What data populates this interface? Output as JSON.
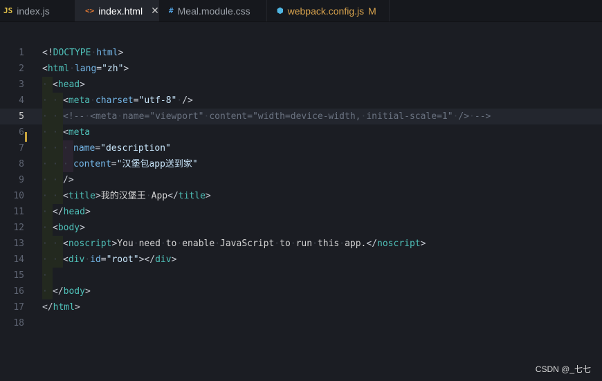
{
  "tabs": [
    {
      "icon": "JS",
      "label": "index.js",
      "active": false
    },
    {
      "icon": "<>",
      "label": "index.html",
      "active": true,
      "close": "✕"
    },
    {
      "icon": "#",
      "label": "Meal.module.css",
      "active": false
    },
    {
      "icon": "⬢",
      "label": "webpack.config.js",
      "active": false,
      "modified": "M"
    }
  ],
  "colors": {
    "background": "#1b1d23",
    "tag": "#4fc1b9",
    "attribute": "#73b5e6",
    "string": "#c9e6fb",
    "comment": "#6a7280",
    "modified": "#d7a24d"
  },
  "code": {
    "current_line": 5,
    "line_numbers": [
      "1",
      "2",
      "3",
      "4",
      "5",
      "6",
      "7",
      "8",
      "9",
      "10",
      "11",
      "12",
      "13",
      "14",
      "15",
      "16",
      "17",
      "18"
    ],
    "lines": [
      {
        "indent": 0,
        "tokens": [
          [
            "br",
            "<!"
          ],
          [
            "tag",
            "DOCTYPE"
          ],
          [
            "sp"
          ],
          [
            "attr",
            "html"
          ],
          [
            "br",
            ">"
          ]
        ]
      },
      {
        "indent": 0,
        "tokens": [
          [
            "br",
            "<"
          ],
          [
            "tag",
            "html"
          ],
          [
            "sp"
          ],
          [
            "attr",
            "lang"
          ],
          [
            "br",
            "="
          ],
          [
            "str",
            "\"zh\""
          ],
          [
            "br",
            ">"
          ]
        ]
      },
      {
        "indent": 1,
        "tokens": [
          [
            "br",
            "<"
          ],
          [
            "tag",
            "head"
          ],
          [
            "br",
            ">"
          ]
        ]
      },
      {
        "indent": 2,
        "tokens": [
          [
            "br",
            "<"
          ],
          [
            "tag",
            "meta"
          ],
          [
            "sp"
          ],
          [
            "attr",
            "charset"
          ],
          [
            "br",
            "="
          ],
          [
            "str",
            "\"utf-8\""
          ],
          [
            "sp"
          ],
          [
            "br",
            "/>"
          ]
        ]
      },
      {
        "indent": 2,
        "tokens": [
          [
            "cm",
            "<!--"
          ],
          [
            "sp"
          ],
          [
            "cm",
            "<meta"
          ],
          [
            "sp"
          ],
          [
            "cm",
            "name=\"viewport\""
          ],
          [
            "sp"
          ],
          [
            "cm",
            "content=\"width=device-width,"
          ],
          [
            "sp"
          ],
          [
            "cm",
            "initial-scale=1\""
          ],
          [
            "sp"
          ],
          [
            "cm",
            "/>"
          ],
          [
            "sp"
          ],
          [
            "cm",
            "-->"
          ]
        ]
      },
      {
        "indent": 2,
        "tokens": [
          [
            "br",
            "<"
          ],
          [
            "tag",
            "meta"
          ]
        ]
      },
      {
        "indent": 3,
        "tokens": [
          [
            "attr",
            "name"
          ],
          [
            "br",
            "="
          ],
          [
            "str",
            "\"description\""
          ]
        ]
      },
      {
        "indent": 3,
        "tokens": [
          [
            "attr",
            "content"
          ],
          [
            "br",
            "="
          ],
          [
            "str",
            "\"汉堡包app送到家\""
          ]
        ]
      },
      {
        "indent": 2,
        "tokens": [
          [
            "br",
            "/>"
          ]
        ]
      },
      {
        "indent": 2,
        "tokens": [
          [
            "br",
            "<"
          ],
          [
            "tag",
            "title"
          ],
          [
            "br",
            ">"
          ],
          [
            "txt",
            "我的汉堡王"
          ],
          [
            "sp"
          ],
          [
            "txt",
            "App"
          ],
          [
            "br",
            "</"
          ],
          [
            "tag",
            "title"
          ],
          [
            "br",
            ">"
          ]
        ]
      },
      {
        "indent": 1,
        "tokens": [
          [
            "br",
            "</"
          ],
          [
            "tag",
            "head"
          ],
          [
            "br",
            ">"
          ]
        ]
      },
      {
        "indent": 1,
        "tokens": [
          [
            "br",
            "<"
          ],
          [
            "tag",
            "body"
          ],
          [
            "br",
            ">"
          ]
        ]
      },
      {
        "indent": 2,
        "tokens": [
          [
            "br",
            "<"
          ],
          [
            "tag",
            "noscript"
          ],
          [
            "br",
            ">"
          ],
          [
            "txt",
            "You"
          ],
          [
            "sp"
          ],
          [
            "txt",
            "need"
          ],
          [
            "sp"
          ],
          [
            "txt",
            "to"
          ],
          [
            "sp"
          ],
          [
            "txt",
            "enable"
          ],
          [
            "sp"
          ],
          [
            "txt",
            "JavaScript"
          ],
          [
            "sp"
          ],
          [
            "txt",
            "to"
          ],
          [
            "sp"
          ],
          [
            "txt",
            "run"
          ],
          [
            "sp"
          ],
          [
            "txt",
            "this"
          ],
          [
            "sp"
          ],
          [
            "txt",
            "app."
          ],
          [
            "br",
            "</"
          ],
          [
            "tag",
            "noscript"
          ],
          [
            "br",
            ">"
          ]
        ]
      },
      {
        "indent": 2,
        "tokens": [
          [
            "br",
            "<"
          ],
          [
            "tag",
            "div"
          ],
          [
            "sp"
          ],
          [
            "attr",
            "id"
          ],
          [
            "br",
            "="
          ],
          [
            "str",
            "\"root\""
          ],
          [
            "br",
            "></"
          ],
          [
            "tag",
            "div"
          ],
          [
            "br",
            ">"
          ]
        ]
      },
      {
        "indent": 1,
        "tokens": []
      },
      {
        "indent": 1,
        "tokens": [
          [
            "br",
            "</"
          ],
          [
            "tag",
            "body"
          ],
          [
            "br",
            ">"
          ]
        ]
      },
      {
        "indent": 0,
        "tokens": [
          [
            "br",
            "</"
          ],
          [
            "tag",
            "html"
          ],
          [
            "br",
            ">"
          ]
        ]
      },
      {
        "indent": 0,
        "tokens": []
      }
    ]
  },
  "watermark": "CSDN @_七七"
}
